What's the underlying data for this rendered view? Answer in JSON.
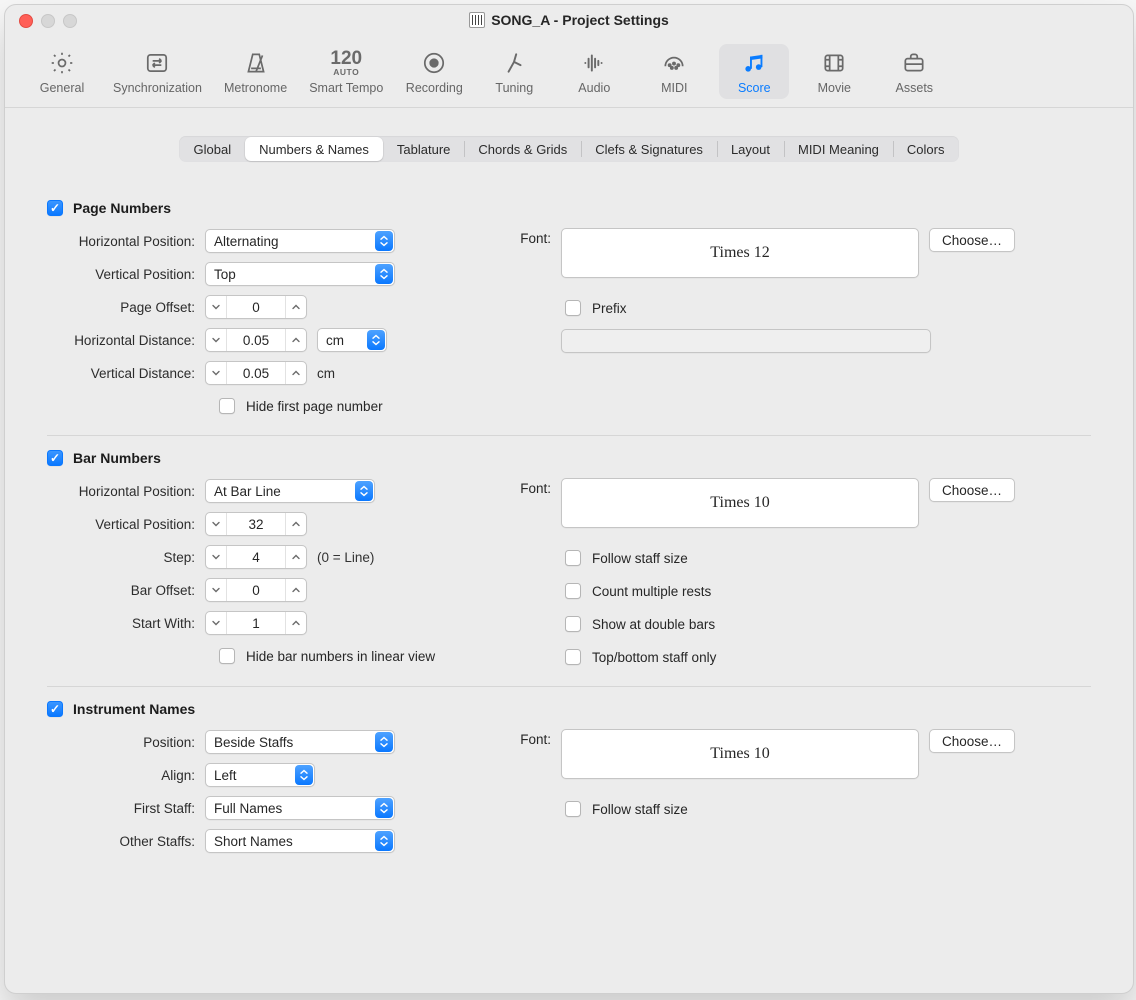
{
  "window": {
    "title": "SONG_A - Project Settings"
  },
  "toolbar": {
    "general": "General",
    "sync": "Synchronization",
    "metronome": "Metronome",
    "smart": {
      "big": "120",
      "small": "AUTO",
      "label": "Smart Tempo"
    },
    "recording": "Recording",
    "tuning": "Tuning",
    "audio": "Audio",
    "midi": "MIDI",
    "score": "Score",
    "movie": "Movie",
    "assets": "Assets"
  },
  "tabs": {
    "global": "Global",
    "numbers_names": "Numbers & Names",
    "tablature": "Tablature",
    "chords_grids": "Chords & Grids",
    "clefs_sigs": "Clefs & Signatures",
    "layout": "Layout",
    "midi_meaning": "MIDI Meaning",
    "colors": "Colors"
  },
  "common": {
    "font_label": "Font:",
    "choose": "Choose…"
  },
  "page_numbers": {
    "title": "Page Numbers",
    "horizontal_position_label": "Horizontal Position:",
    "horizontal_position": "Alternating",
    "vertical_position_label": "Vertical Position:",
    "vertical_position": "Top",
    "page_offset_label": "Page Offset:",
    "page_offset": "0",
    "horizontal_distance_label": "Horizontal Distance:",
    "horizontal_distance": "0.05",
    "horizontal_unit": "cm",
    "vertical_distance_label": "Vertical Distance:",
    "vertical_distance": "0.05",
    "vertical_unit": "cm",
    "hide_first": "Hide first page number",
    "font": "Times 12",
    "prefix_label": "Prefix",
    "prefix_value": ""
  },
  "bar_numbers": {
    "title": "Bar Numbers",
    "horizontal_position_label": "Horizontal Position:",
    "horizontal_position": "At Bar Line",
    "vertical_position_label": "Vertical Position:",
    "vertical_position": "32",
    "step_label": "Step:",
    "step": "4",
    "step_hint": "(0 = Line)",
    "bar_offset_label": "Bar Offset:",
    "bar_offset": "0",
    "start_with_label": "Start With:",
    "start_with": "1",
    "hide_linear": "Hide bar numbers in linear view",
    "font": "Times 10",
    "follow_staff": "Follow staff size",
    "count_rests": "Count multiple rests",
    "double_bars": "Show at double bars",
    "top_bottom": "Top/bottom staff only"
  },
  "instrument_names": {
    "title": "Instrument Names",
    "position_label": "Position:",
    "position": "Beside Staffs",
    "align_label": "Align:",
    "align": "Left",
    "first_staff_label": "First Staff:",
    "first_staff": "Full Names",
    "other_staffs_label": "Other Staffs:",
    "other_staffs": "Short Names",
    "font": "Times 10",
    "follow_staff": "Follow staff size"
  }
}
